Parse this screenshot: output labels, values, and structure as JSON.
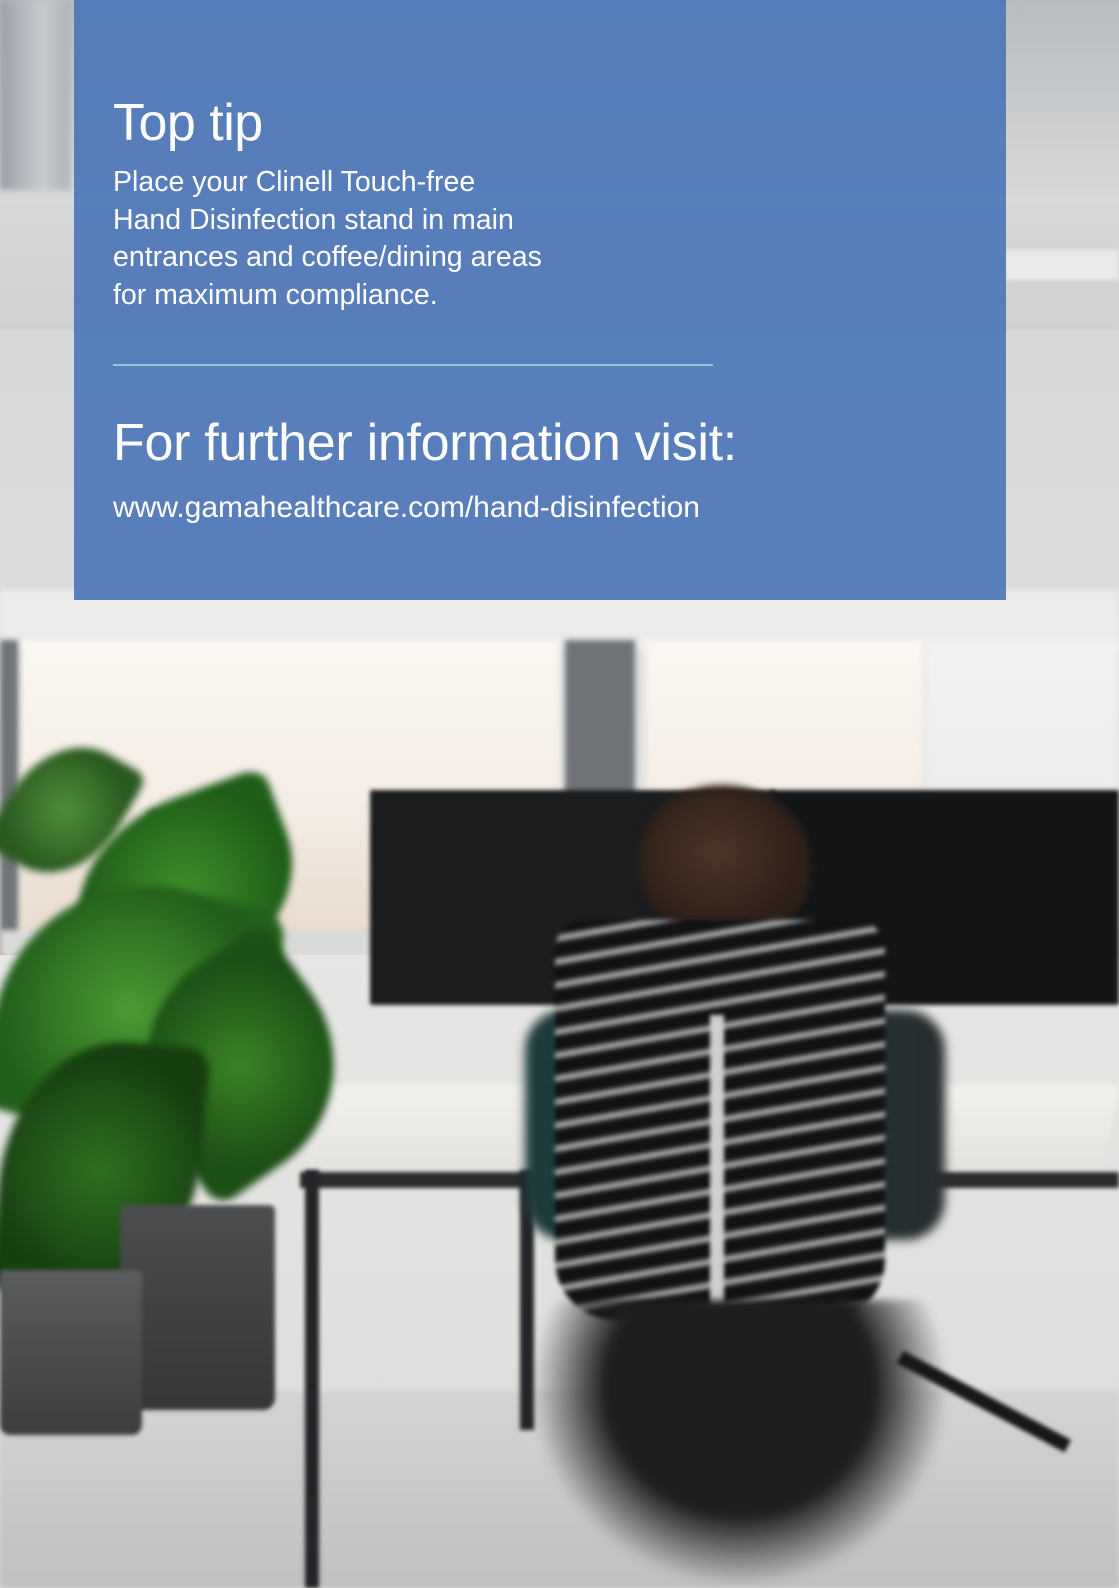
{
  "panel": {
    "tip_heading": "Top tip",
    "tip_lines": [
      "Place your Clinell Touch-free",
      "Hand Disinfection stand in main",
      "entrances and coffee/dining areas",
      "for maximum compliance."
    ],
    "info_heading": "For further information visit:",
    "info_url": "www.gamahealthcare.com/hand-disinfection"
  },
  "colors": {
    "panel_background": "#4d77b9",
    "divider": "#8cc8d6",
    "text": "#ffffff"
  }
}
